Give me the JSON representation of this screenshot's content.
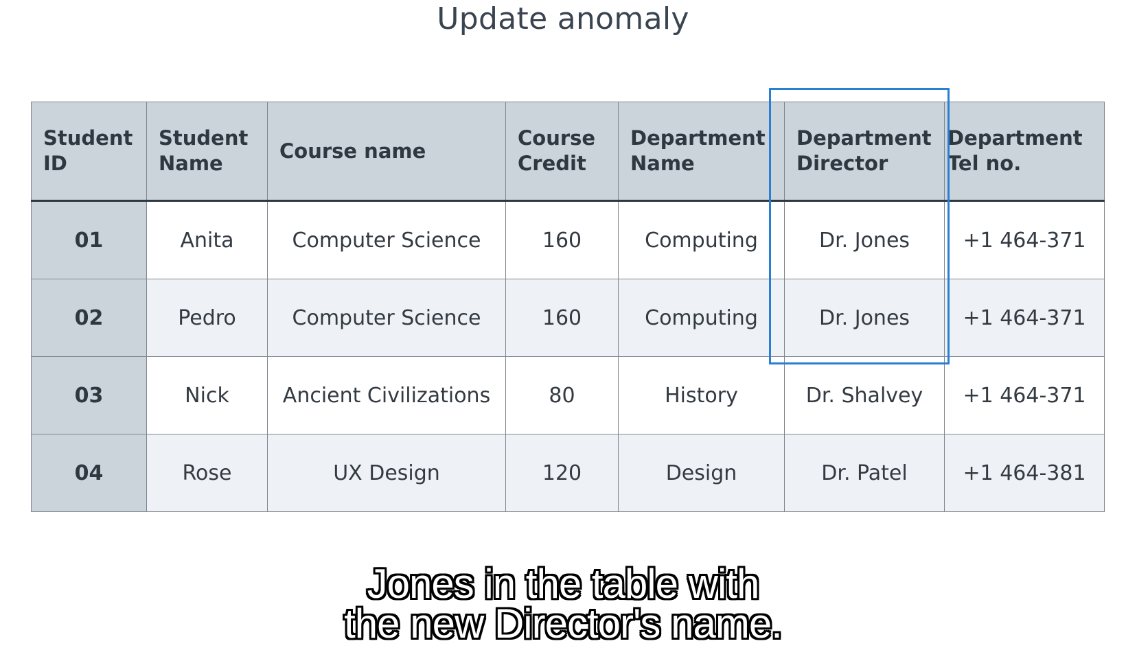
{
  "title": "Update anomaly",
  "table": {
    "headers": [
      [
        "Student",
        "ID"
      ],
      [
        "Student",
        "Name"
      ],
      [
        "Course name",
        ""
      ],
      [
        "Course",
        "Credit"
      ],
      [
        "Department",
        "Name"
      ],
      [
        "Department",
        "Director"
      ],
      [
        "Department",
        "Tel no."
      ]
    ],
    "rows": [
      [
        "01",
        "Anita",
        "Computer Science",
        "160",
        "Computing",
        "Dr. Jones",
        "+1 464-371"
      ],
      [
        "02",
        "Pedro",
        "Computer Science",
        "160",
        "Computing",
        "Dr. Jones",
        "+1 464-371"
      ],
      [
        "03",
        "Nick",
        "Ancient Civilizations",
        "80",
        "History",
        "Dr. Shalvey",
        "+1 464-371"
      ],
      [
        "04",
        "Rose",
        "UX Design",
        "120",
        "Design",
        "Dr. Patel",
        "+1 464-381"
      ]
    ]
  },
  "highlight": {
    "column": "Department Director",
    "rows": [
      "01",
      "02"
    ],
    "color": "#2a7fd4"
  },
  "caption": {
    "line1": "Jones in the table with",
    "line2": "the new Director's name."
  },
  "colors": {
    "header_bg": "#cbd3db",
    "row_alt_bg": "#eef2f6",
    "text": "#333a42"
  }
}
